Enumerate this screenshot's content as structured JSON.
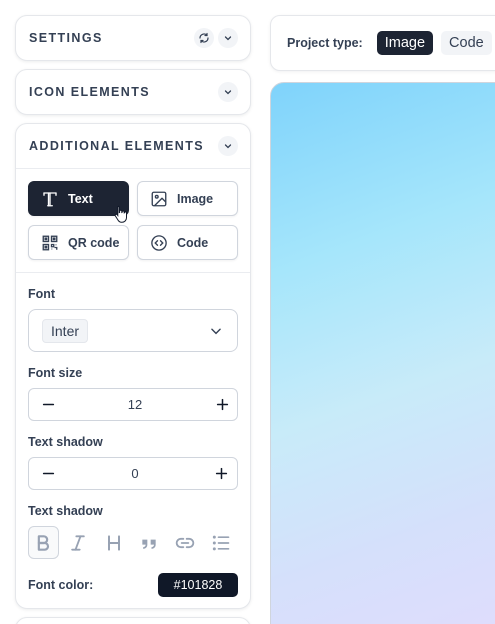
{
  "sidebar": {
    "settings": {
      "title": "SETTINGS"
    },
    "icon_elements": {
      "title": "ICON ELEMENTS"
    },
    "additional": {
      "title": "ADDITIONAL ELEMENTS",
      "elements": [
        {
          "label": "Text",
          "icon": "text-icon",
          "active": true
        },
        {
          "label": "Image",
          "icon": "image-icon",
          "active": false
        },
        {
          "label": "QR code",
          "icon": "qr-code-icon",
          "active": false
        },
        {
          "label": "Code",
          "icon": "code-icon",
          "active": false
        }
      ],
      "font": {
        "label": "Font",
        "value": "Inter"
      },
      "font_size": {
        "label": "Font size",
        "value": "12"
      },
      "text_shadow": {
        "label": "Text shadow",
        "value": "0"
      },
      "text_format": {
        "label": "Text shadow",
        "buttons": [
          "bold-icon",
          "italic-icon",
          "heading-icon",
          "quote-icon",
          "link-icon",
          "list-icon"
        ],
        "active": "bold-icon"
      },
      "font_color": {
        "label": "Font color:",
        "value": "#101828"
      }
    }
  },
  "topbar": {
    "label": "Project type:",
    "tabs": [
      {
        "label": "Image",
        "active": true
      },
      {
        "label": "Code",
        "active": false
      }
    ]
  },
  "colors": {
    "accent": "#1d2433",
    "font_color": "#101828"
  }
}
